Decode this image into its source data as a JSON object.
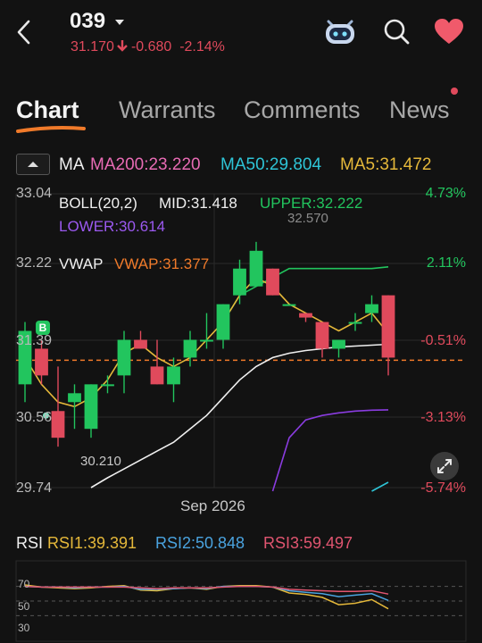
{
  "header": {
    "back_icon": "chevron-left-icon",
    "title": "039",
    "price": "31.170",
    "change": "-0.680",
    "change_pct": "-2.14%",
    "colors": {
      "down": "#e04a5c",
      "up": "#22c55e"
    }
  },
  "tabs": [
    {
      "label": "Chart",
      "active": true
    },
    {
      "label": "Warrants",
      "active": false
    },
    {
      "label": "Comments",
      "active": false
    },
    {
      "label": "News",
      "active": false,
      "badge": true
    }
  ],
  "ma": {
    "label": "MA",
    "ma200": "MA200:23.220",
    "ma50": "MA50:29.804",
    "ma5": "MA5:31.472"
  },
  "boll": {
    "label": "BOLL(20,2)",
    "mid": "MID:31.418",
    "upper": "UPPER:32.222",
    "lower": "LOWER:30.614"
  },
  "vwap": {
    "label": "VWAP",
    "value": "VWAP:31.377"
  },
  "y_axis": [
    "33.04",
    "32.22",
    "31.39",
    "30.56",
    "29.74"
  ],
  "pct_axis": [
    "4.73%",
    "2.11%",
    "-0.51%",
    "-3.13%",
    "-5.74%"
  ],
  "annotations": {
    "high": "32.570",
    "low": "30.210",
    "buy_marker": "B",
    "x_label": "Sep 2026"
  },
  "rsi": {
    "label": "RSI",
    "rsi1": "RSI1:39.391",
    "rsi2": "RSI2:50.848",
    "rsi3": "RSI3:59.497",
    "levels": [
      "70",
      "50",
      "30"
    ]
  },
  "chart_data": {
    "type": "candlestick",
    "ylim": [
      29.74,
      33.04
    ],
    "candles": [
      {
        "o": 30.9,
        "h": 31.6,
        "l": 30.7,
        "c": 31.5
      },
      {
        "o": 31.3,
        "h": 31.4,
        "l": 30.9,
        "c": 31.0
      },
      {
        "o": 30.6,
        "h": 31.1,
        "l": 30.2,
        "c": 30.3
      },
      {
        "o": 30.7,
        "h": 30.9,
        "l": 30.4,
        "c": 30.8
      },
      {
        "o": 30.4,
        "h": 30.9,
        "l": 30.3,
        "c": 30.9
      },
      {
        "o": 30.9,
        "h": 31.0,
        "l": 30.8,
        "c": 30.9
      },
      {
        "o": 31.0,
        "h": 31.5,
        "l": 30.8,
        "c": 31.4
      },
      {
        "o": 31.4,
        "h": 31.5,
        "l": 31.3,
        "c": 31.3
      },
      {
        "o": 31.1,
        "h": 31.4,
        "l": 30.9,
        "c": 30.9
      },
      {
        "o": 30.9,
        "h": 31.2,
        "l": 30.7,
        "c": 31.1
      },
      {
        "o": 31.2,
        "h": 31.5,
        "l": 31.1,
        "c": 31.4
      },
      {
        "o": 31.4,
        "h": 31.7,
        "l": 31.3,
        "c": 31.4
      },
      {
        "o": 31.4,
        "h": 31.8,
        "l": 31.3,
        "c": 31.8
      },
      {
        "o": 31.9,
        "h": 32.3,
        "l": 31.8,
        "c": 32.2
      },
      {
        "o": 32.0,
        "h": 32.5,
        "l": 32.0,
        "c": 32.4
      },
      {
        "o": 32.2,
        "h": 32.2,
        "l": 31.9,
        "c": 31.9
      },
      {
        "o": 31.8,
        "h": 31.8,
        "l": 31.8,
        "c": 31.8
      },
      {
        "o": 31.7,
        "h": 31.7,
        "l": 31.6,
        "c": 31.65
      },
      {
        "o": 31.6,
        "h": 31.6,
        "l": 31.2,
        "c": 31.3
      },
      {
        "o": 31.3,
        "h": 31.4,
        "l": 31.2,
        "c": 31.4
      },
      {
        "o": 31.6,
        "h": 31.7,
        "l": 31.5,
        "c": 31.6
      },
      {
        "o": 31.7,
        "h": 31.9,
        "l": 31.6,
        "c": 31.8
      },
      {
        "o": 31.9,
        "h": 31.9,
        "l": 31.0,
        "c": 31.2
      }
    ],
    "series": [
      {
        "name": "BOLL UPPER",
        "color": "#22c55e",
        "values": [
          null,
          null,
          null,
          null,
          null,
          null,
          null,
          null,
          null,
          null,
          null,
          null,
          31.6,
          31.9,
          32.0,
          32.1,
          32.2,
          32.2,
          32.2,
          32.2,
          32.2,
          32.2,
          32.22
        ]
      },
      {
        "name": "BOLL LOWER",
        "color": "#8a3ce0",
        "values": [
          null,
          null,
          null,
          null,
          null,
          null,
          null,
          null,
          null,
          null,
          null,
          null,
          null,
          null,
          null,
          29.7,
          30.3,
          30.5,
          30.55,
          30.58,
          30.6,
          30.61,
          30.614
        ]
      },
      {
        "name": "MA5",
        "color": "#e5b83a",
        "values": [
          31.2,
          30.9,
          30.7,
          30.65,
          30.75,
          30.95,
          31.25,
          31.35,
          31.2,
          31.1,
          31.2,
          31.4,
          31.6,
          31.9,
          32.1,
          32.0,
          31.8,
          31.7,
          31.6,
          31.5,
          31.6,
          31.7,
          31.47
        ]
      },
      {
        "name": "MA50",
        "color": "#f0f0f0",
        "values": [
          null,
          null,
          null,
          null,
          29.74,
          29.85,
          29.95,
          30.05,
          30.15,
          30.25,
          30.4,
          30.55,
          30.75,
          30.95,
          31.1,
          31.2,
          31.25,
          31.28,
          31.3,
          31.32,
          31.33,
          31.34,
          31.35
        ]
      },
      {
        "name": "MA200",
        "color": "#2ec4d6",
        "values": [
          null,
          null,
          null,
          null,
          null,
          null,
          null,
          null,
          null,
          null,
          null,
          null,
          null,
          null,
          null,
          null,
          null,
          null,
          null,
          null,
          null,
          29.7,
          29.8
        ]
      }
    ],
    "reference_line": 31.17,
    "rsi": [
      {
        "name": "RSI1",
        "color": "#e5b83a",
        "values": [
          72,
          69,
          68,
          67,
          68,
          70,
          71,
          65,
          64,
          67,
          68,
          66,
          70,
          71,
          71,
          69,
          61,
          59,
          55,
          45,
          47,
          52,
          39.391
        ]
      },
      {
        "name": "RSI2",
        "color": "#4aa3df",
        "values": [
          70,
          69,
          69,
          68,
          69,
          69,
          70,
          66,
          66,
          67,
          68,
          67,
          70,
          70,
          70,
          69,
          64,
          62,
          60,
          56,
          58,
          60,
          50.848
        ]
      },
      {
        "name": "RSI3",
        "color": "#e05570",
        "values": [
          70,
          69,
          69,
          69,
          69,
          69,
          69,
          68,
          67,
          68,
          68,
          68,
          69,
          70,
          70,
          69,
          66,
          65,
          64,
          63,
          63,
          64,
          59.497
        ]
      }
    ]
  }
}
